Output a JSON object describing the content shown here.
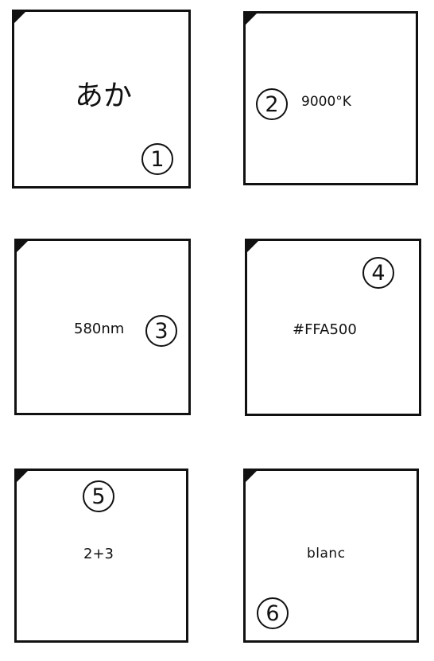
{
  "cards": [
    {
      "label": "あか",
      "number": "1"
    },
    {
      "label": "9000°K",
      "number": "2"
    },
    {
      "label": "580nm",
      "number": "3"
    },
    {
      "label": "#FFA500",
      "number": "4"
    },
    {
      "label": "2+3",
      "number": "5"
    },
    {
      "label": "blanc",
      "number": "6"
    }
  ]
}
